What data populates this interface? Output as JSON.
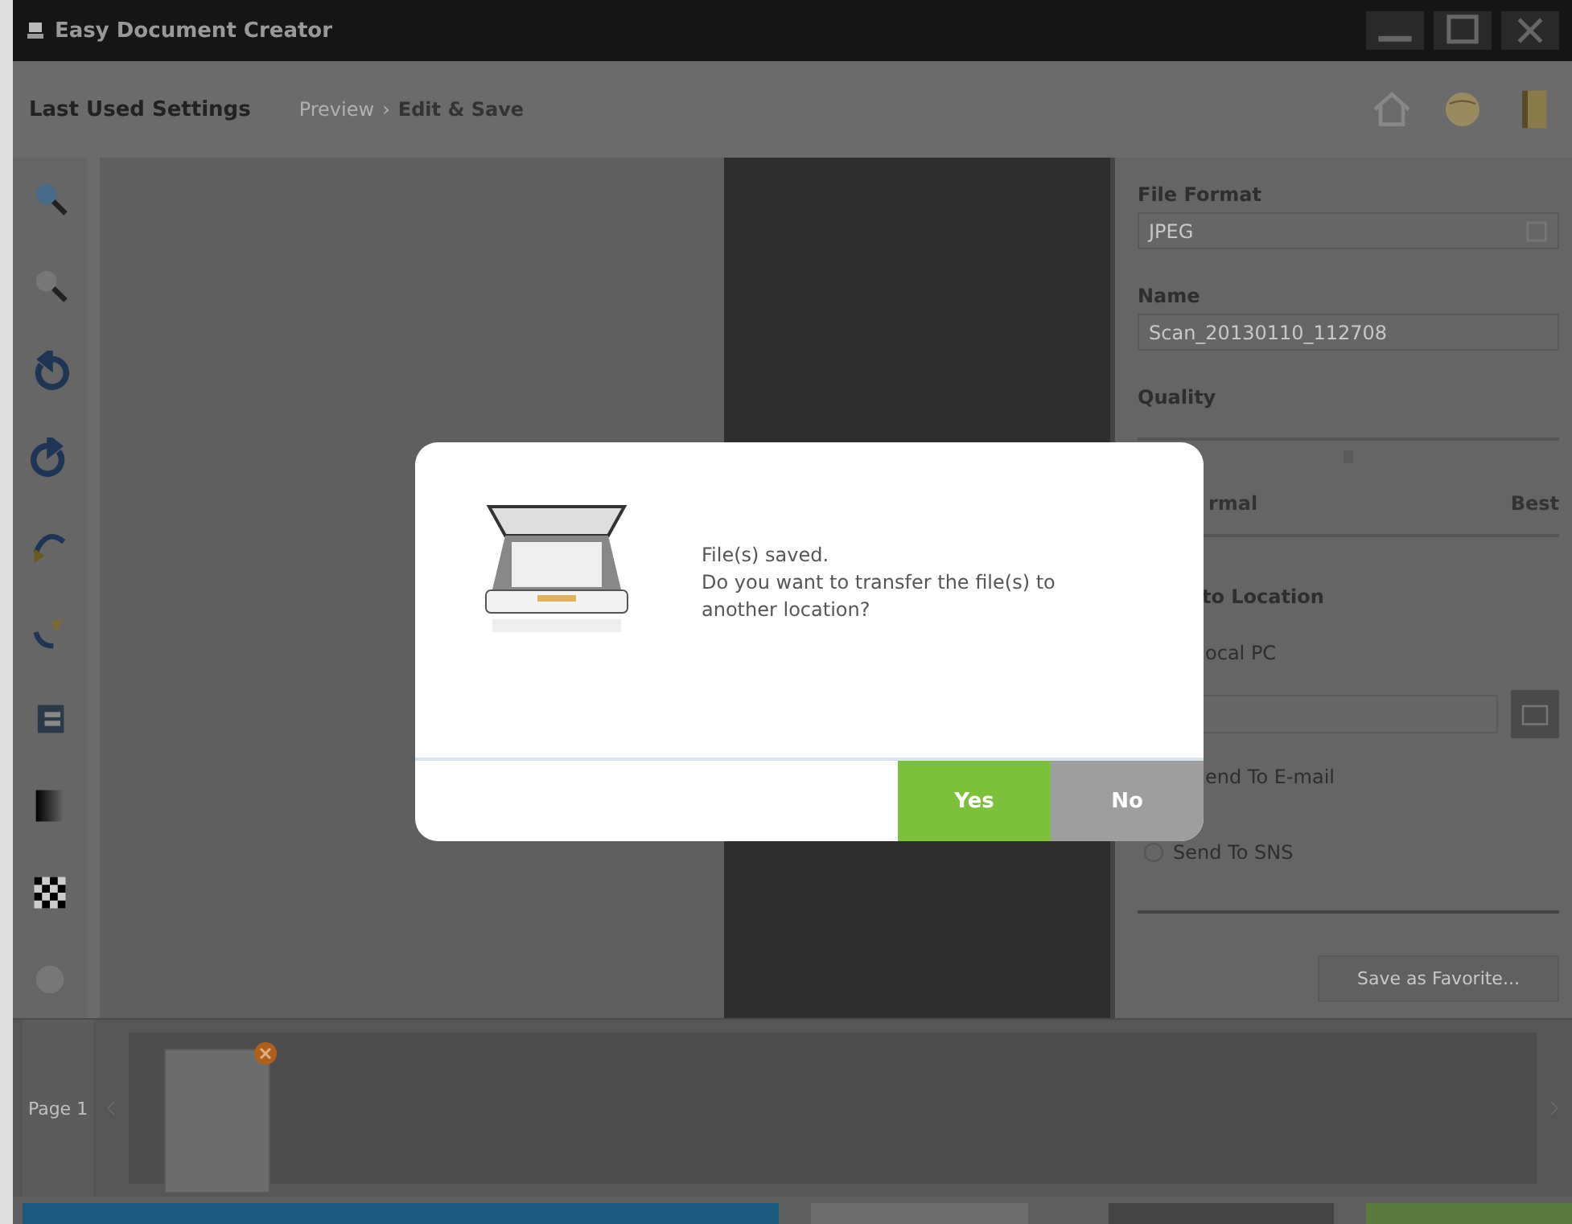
{
  "window": {
    "title": "Easy Document Creator"
  },
  "header": {
    "settings": "Last Used Settings",
    "separator": "›",
    "breadcrumb": [
      {
        "label": "Preview",
        "selected": false
      },
      {
        "label": "Edit & Save",
        "selected": true
      }
    ]
  },
  "thumbnails": {
    "page_label": "Page 1"
  },
  "panel": {
    "file_format_label": "File Format",
    "file_format_value": "JPEG",
    "name_label": "Name",
    "name_value": "Scan_20130110_112708",
    "quality_label": "Quality",
    "quality_min": "rmal",
    "quality_max": "Best",
    "location_label": "to Location",
    "quality_slider": {
      "level": 0.5
    },
    "options": [
      {
        "label": "ocal PC"
      },
      {
        "label": "end To E-mail"
      },
      {
        "label": "Send To SNS",
        "selected": false
      }
    ],
    "favorite_button": "Save as Favorite..."
  },
  "dialog": {
    "line1": "File(s) saved.",
    "line2": "Do you want to transfer the file(s) to another location?",
    "yes": "Yes",
    "no": "No"
  }
}
